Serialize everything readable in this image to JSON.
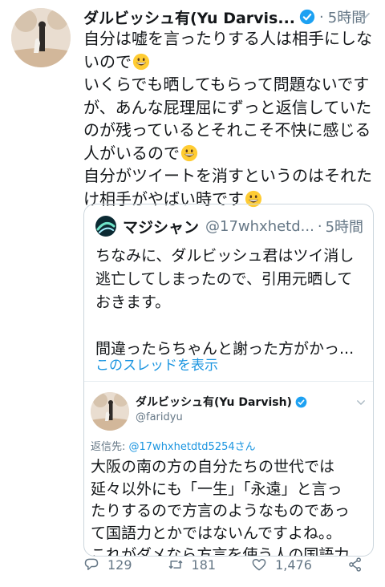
{
  "tweet": {
    "display_name": "ダルビッシュ有(Yu Darvis...",
    "timestamp": "5時間",
    "text_lines": [
      "自分は嘘を言ったりする人は相手にしな",
      "いので",
      "いくらでも晒してもらって問題ないです",
      "が、あんな屁理屈にずっと返信していた",
      "のが残っているとそれこそ不快に感じる",
      "人がいるので",
      "自分がツイートを消すというのはそれた",
      "け相手がやばい時です"
    ],
    "emoji_icon": "grinning-face-icon"
  },
  "quote": {
    "display_name": "マジシャン",
    "handle": "@17whxhetd...",
    "timestamp": "5時間",
    "text_lines": [
      "ちなみに、ダルビッシュ君はツイ消し",
      "逃亡してしまったので、引用元晒して",
      "おきます。",
      "",
      "間違ったらちゃんと謝った方がかっ..."
    ],
    "show_thread": "このスレッドを表示"
  },
  "nested": {
    "display_name": "ダルビッシュ有(Yu Darvish)",
    "handle": "@faridyu",
    "reply_prefix": "返信先: ",
    "reply_mention": "@17whxhetdtd5254さん",
    "text_lines": [
      "大阪の南の方の自分たちの世代では",
      "延々以外にも「一生」「永遠」と言っ",
      "たりするので方言のようなものであっ",
      "て国語力とかではないんですよね。。",
      "これがダメなら方言を使う人の国語力"
    ]
  },
  "actions": {
    "reply_count": "129",
    "retweet_count": "181",
    "like_count": "1,476"
  },
  "colors": {
    "link": "#1b95e0",
    "secondary_text": "#657786",
    "border": "#ccd6dd",
    "verified": "#1da1f2"
  }
}
